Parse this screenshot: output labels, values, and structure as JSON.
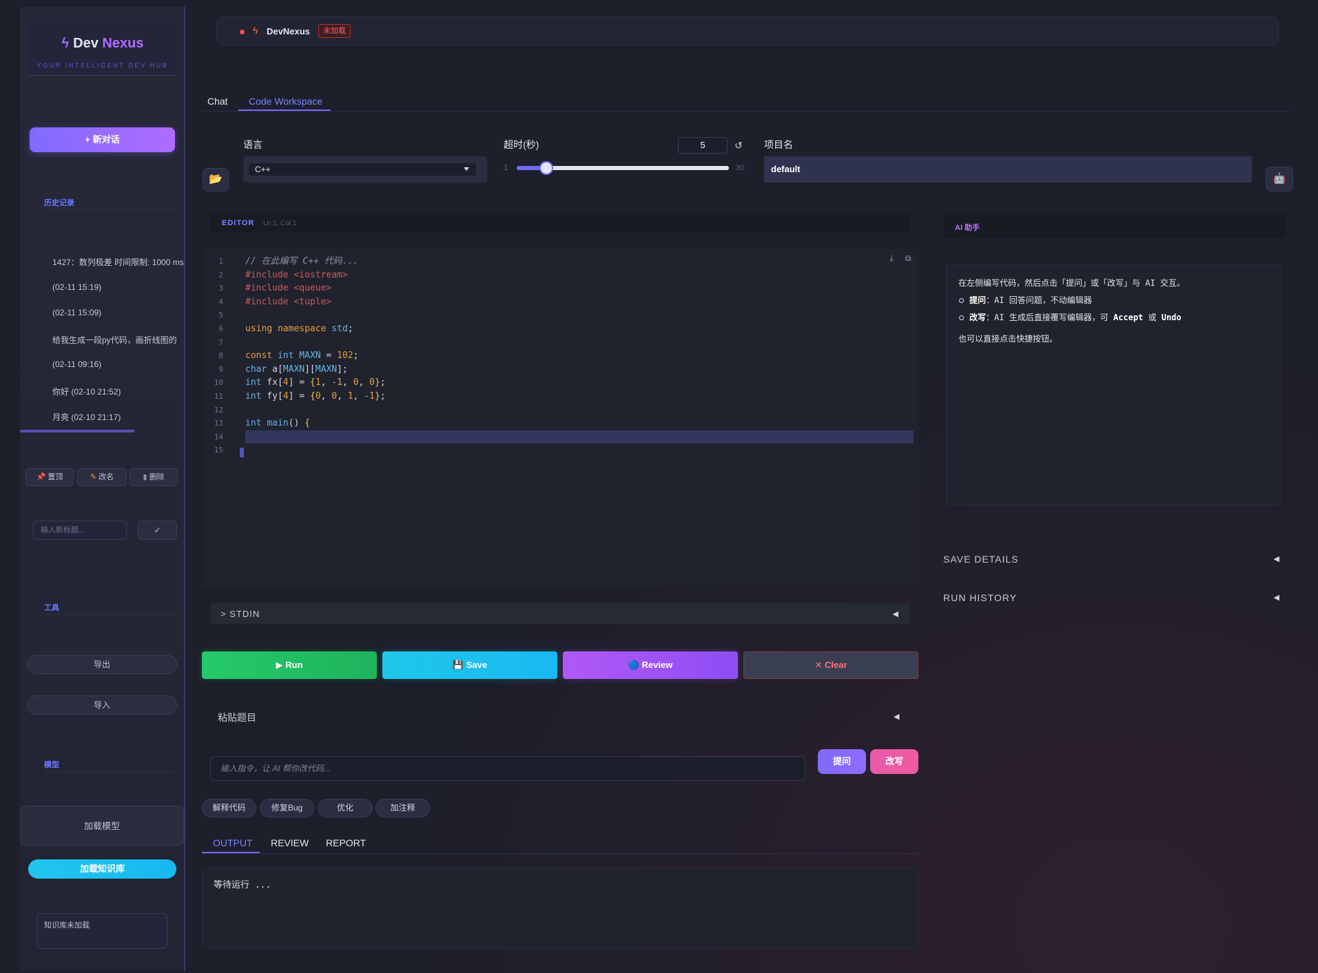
{
  "sidebar": {
    "logo": {
      "dev": "Dev",
      "nexus": "Nexus",
      "subtitle": "YOUR INTELLIGENT DEV HUB"
    },
    "new_chat": "+ 新对话",
    "history_label": "历史记录",
    "history": [
      "1427：数列极差 时间限制: 1000 ms",
      "(02-11 15:19)",
      "(02-11 15:09)",
      "给我生成一段py代码，画折线图的",
      "(02-11 09:16)",
      "你好 (02-10 21:52)",
      "月亮 (02-10 21:17)"
    ],
    "actions": {
      "pin": "置顶",
      "rename": "改名",
      "delete": "删除"
    },
    "rename_placeholder": "输入新标题...",
    "confirm": "✓",
    "tools_label": "工具",
    "export": "导出",
    "import": "导入",
    "model_label": "模型",
    "load_model": "加载模型",
    "load_kb": "加载知识库",
    "kb_status": "知识库未加载"
  },
  "header": {
    "title": "DevNexus",
    "badge": "未加载",
    "status_color": "#ff4d4d"
  },
  "tabs": [
    {
      "label": "Chat"
    },
    {
      "label": "Code Workspace",
      "active": true
    }
  ],
  "config": {
    "language_label": "语言",
    "language_value": "C++",
    "timeout_label": "超时(秒)",
    "timeout_value": "5",
    "timeout_min": "1",
    "timeout_max": "30",
    "timeout_fraction": 0.138,
    "project_label": "项目名",
    "project_value": "default"
  },
  "editor": {
    "title": "EDITOR",
    "position": "Ln 1, Col 1",
    "line_numbers": [
      "1",
      "2",
      "3",
      "4",
      "5",
      "6",
      "7",
      "8",
      "9",
      "10",
      "11",
      "12",
      "13",
      "14",
      "15"
    ],
    "lines": [
      "// 在此编写 C++ 代码...",
      "#include <iostream>",
      "#include <queue>",
      "#include <tuple>",
      "",
      "using namespace std;",
      "",
      "const int MAXN = 102;",
      "char a[MAXN][MAXN];",
      "int fx[4] = {1, -1, 0, 0};",
      "int fy[4] = {0, 0, 1, -1};",
      "",
      "int main() {",
      "",
      ""
    ]
  },
  "stdin": {
    "label": "> STDIN"
  },
  "actions": {
    "run": "▶ Run",
    "save": "💾 Save",
    "review": "🔵 Review",
    "clear": "✕ Clear"
  },
  "paste_problem": "粘贴题目",
  "instruction": {
    "placeholder": "输入指令，让 AI 帮你改代码...",
    "ask": "提问",
    "rewrite": "改写"
  },
  "quick_actions": [
    "解释代码",
    "修复Bug",
    "优化",
    "加注释"
  ],
  "output_tabs": [
    {
      "label": "OUTPUT",
      "active": true
    },
    {
      "label": "REVIEW"
    },
    {
      "label": "REPORT"
    }
  ],
  "output_text": "等待运行 ...",
  "ai_panel": {
    "title": "AI 助手",
    "intro": "在左侧编写代码，然后点击「提问」或「改写」与 AI 交互。",
    "items": [
      {
        "term": "提问",
        "desc": "：AI 回答问题，不动编辑器"
      },
      {
        "term": "改写",
        "desc": "：AI 生成后直接覆写编辑器，可 "
      }
    ],
    "accept": "Accept",
    "or": " 或 ",
    "undo": "Undo",
    "footer": "也可以直接点击快捷按钮。"
  },
  "right_sections": {
    "save_details": "SAVE DETAILS",
    "run_history": "RUN HISTORY"
  }
}
